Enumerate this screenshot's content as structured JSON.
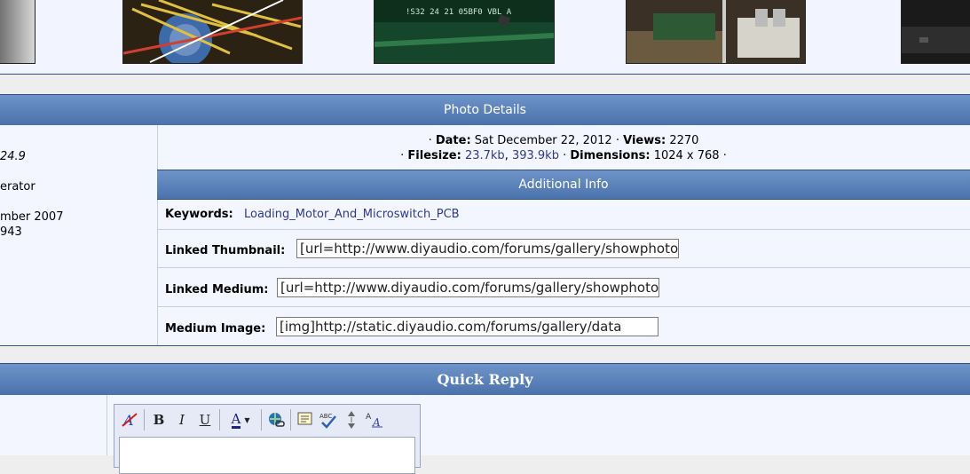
{
  "thumbnails": [
    {
      "name": "thumbnail-1",
      "colors": [
        "#8a8a8a",
        "#c9c9c9"
      ]
    },
    {
      "name": "thumbnail-2",
      "colors": [
        "#3c2a12",
        "#d9a441"
      ]
    },
    {
      "name": "thumbnail-3",
      "colors": [
        "#0c3b22",
        "#2f8a4f"
      ]
    },
    {
      "name": "thumbnail-4",
      "colors": [
        "#2a2016",
        "#c8c0b0"
      ]
    },
    {
      "name": "thumbnail-5",
      "colors": [
        "#111111",
        "#4a4a4a"
      ]
    }
  ],
  "photo_details": {
    "header": "Photo Details",
    "date_label": "Date:",
    "date_value": "Sat December 22, 2012",
    "views_label": "Views:",
    "views_value": "2270",
    "filesize_label": "Filesize:",
    "filesize_small": "23.7kb",
    "filesize_large": "393.9kb",
    "dimensions_label": "Dimensions:",
    "dimensions_value": "1024 x 768",
    "bullet": "·"
  },
  "sidebar": {
    "line1": "24.9",
    "line2": "erator",
    "line3": "mber 2007",
    "line4": "943"
  },
  "additional_info": {
    "header": "Additional Info",
    "keywords_label": "Keywords:",
    "keywords_value": "Loading_Motor_And_Microswitch_PCB",
    "linked_thumbnail_label": "Linked Thumbnail:",
    "linked_thumbnail_value": "[url=http://www.diyaudio.com/forums/gallery/showphoto",
    "linked_medium_label": "Linked Medium:",
    "linked_medium_value": "[url=http://www.diyaudio.com/forums/gallery/showphoto",
    "medium_image_label": "Medium Image:",
    "medium_image_value": "[img]http://static.diyaudio.com/forums/gallery/data"
  },
  "quick_reply": {
    "header": "Quick Reply",
    "toolbar": {
      "bold": "B",
      "italic": "I",
      "underline": "U",
      "font_color": "A"
    }
  }
}
